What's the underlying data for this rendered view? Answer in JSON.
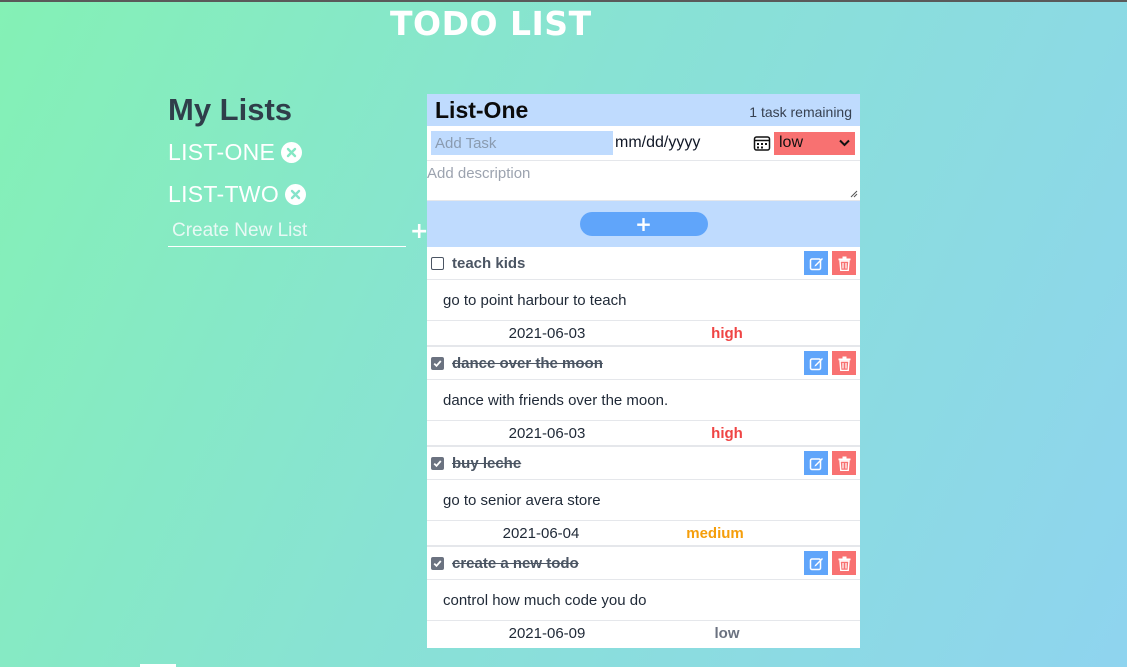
{
  "app": {
    "title": "TODO LIST"
  },
  "sidebar": {
    "title": "My Lists",
    "lists": [
      {
        "label": "LIST-ONE"
      },
      {
        "label": "LIST-TWO"
      }
    ],
    "new_list_placeholder": "Create New List",
    "add_icon": "+"
  },
  "panel": {
    "title": "List-One",
    "remaining": "1 task remaining",
    "form": {
      "task_placeholder": "Add Task",
      "date_placeholder": "mm/dd/yyyy",
      "priority_value": "low",
      "description_placeholder": "Add description",
      "add_button": "+"
    },
    "todos": [
      {
        "title": "teach kids",
        "description": "go to point harbour to teach",
        "date": "2021-06-03",
        "priority": "high",
        "done": false
      },
      {
        "title": "dance over the moon",
        "description": "dance with friends over the moon.",
        "date": "2021-06-03",
        "priority": "high",
        "done": true
      },
      {
        "title": "buy leche",
        "description": "go to senior avera store",
        "date": "2021-06-04",
        "priority": "medium",
        "done": true
      },
      {
        "title": "create a new todo",
        "description": "control how much code you do",
        "date": "2021-06-09",
        "priority": "low",
        "done": true
      }
    ]
  },
  "colors": {
    "high": "#ef4444",
    "medium": "#f59e0b",
    "low": "#6b7280",
    "accent_blue": "#60a5fa",
    "accent_red": "#f87171"
  },
  "icons": {
    "list_delete": "close-circle-icon",
    "calendar": "calendar-icon",
    "edit": "edit-icon",
    "delete": "trash-icon",
    "dropdown": "chevron-down-icon"
  }
}
